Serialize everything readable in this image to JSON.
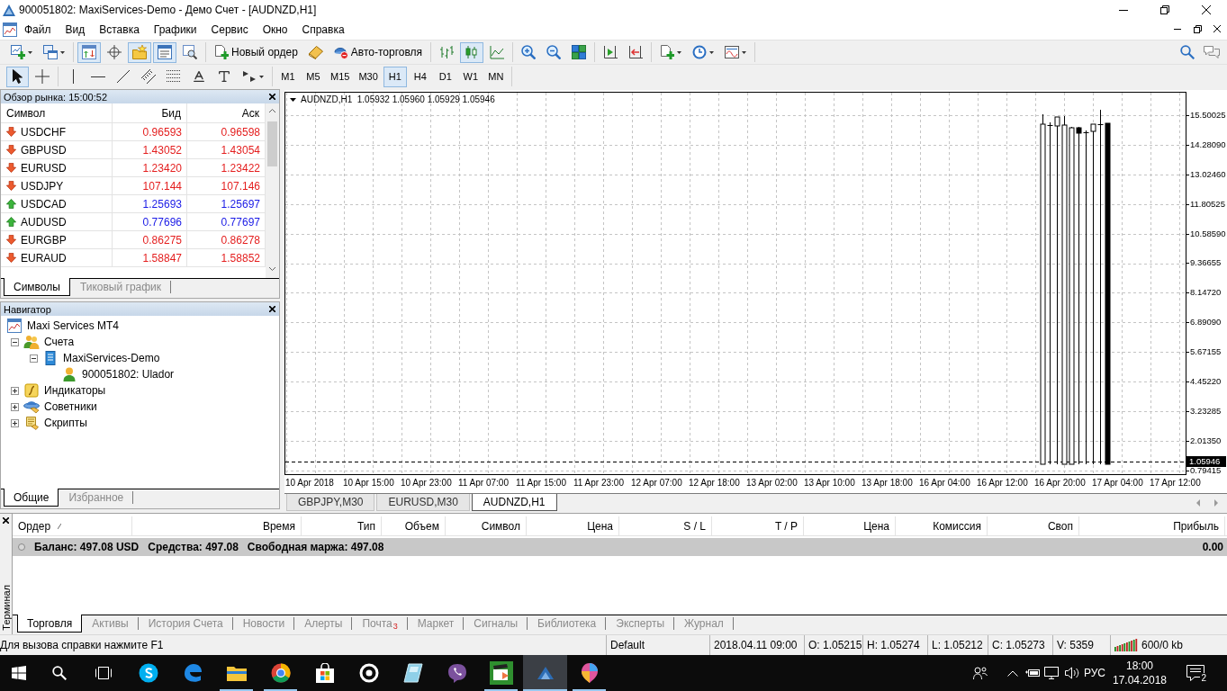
{
  "window": {
    "title": "900051802: MaxiServices-Demo - Демо Счет - [AUDNZD,H1]"
  },
  "menu": [
    "Файл",
    "Вид",
    "Вставка",
    "Графики",
    "Сервис",
    "Окно",
    "Справка"
  ],
  "toolbar": {
    "groups": [
      [
        {
          "kind": "icon",
          "pressed": false
        },
        {
          "kind": "icon",
          "pressed": false
        }
      ],
      [
        {
          "kind": "icon",
          "pressed": true
        },
        {
          "kind": "icon",
          "pressed": false
        },
        {
          "kind": "icon",
          "pressed": true
        },
        {
          "kind": "icon",
          "pressed": true
        },
        {
          "kind": "icon",
          "pressed": false
        }
      ],
      [
        {
          "kind": "labeled",
          "label": "Новый ордер",
          "pressed": false
        },
        {
          "kind": "icon",
          "pressed": false
        },
        {
          "kind": "labeled",
          "label": "Авто-торговля",
          "pressed": false
        }
      ],
      [
        {
          "kind": "icon",
          "pressed": false
        },
        {
          "kind": "icon",
          "pressed": true
        },
        {
          "kind": "icon",
          "pressed": false
        }
      ],
      [
        {
          "kind": "icon",
          "pressed": false
        },
        {
          "kind": "icon",
          "pressed": false
        },
        {
          "kind": "icon",
          "pressed": false
        }
      ],
      [
        {
          "kind": "icon",
          "pressed": false
        },
        {
          "kind": "icon",
          "pressed": false
        }
      ],
      [
        {
          "kind": "icon",
          "pressed": false
        },
        {
          "kind": "icon",
          "pressed": false
        },
        {
          "kind": "icon",
          "pressed": false
        }
      ]
    ]
  },
  "drawing_toolbar": {
    "tools": [
      {
        "pressed": true
      },
      {
        "pressed": false
      },
      {
        "pressed": false
      },
      {
        "pressed": false
      },
      {
        "pressed": false
      },
      {
        "pressed": false
      },
      {
        "pressed": false
      },
      {
        "pressed": false
      },
      {
        "pressed": false
      },
      {
        "pressed": false
      }
    ],
    "periods": [
      {
        "label": "M1",
        "selected": false
      },
      {
        "label": "M5",
        "selected": false
      },
      {
        "label": "M15",
        "selected": false
      },
      {
        "label": "M30",
        "selected": false
      },
      {
        "label": "H1",
        "selected": true
      },
      {
        "label": "H4",
        "selected": false
      },
      {
        "label": "D1",
        "selected": false
      },
      {
        "label": "W1",
        "selected": false
      },
      {
        "label": "MN",
        "selected": false
      }
    ]
  },
  "market_watch": {
    "title": "Обзор рынка: 15:00:52",
    "columns": [
      "Символ",
      "Бид",
      "Аск"
    ],
    "rows": [
      {
        "symbol": "USDCHF",
        "rising": false,
        "bid": "0.96593",
        "ask": "0.96598"
      },
      {
        "symbol": "GBPUSD",
        "rising": false,
        "bid": "1.43052",
        "ask": "1.43054"
      },
      {
        "symbol": "EURUSD",
        "rising": false,
        "bid": "1.23420",
        "ask": "1.23422"
      },
      {
        "symbol": "USDJPY",
        "rising": false,
        "bid": "107.144",
        "ask": "107.146"
      },
      {
        "symbol": "USDCAD",
        "rising": true,
        "bid": "1.25693",
        "ask": "1.25697"
      },
      {
        "symbol": "AUDUSD",
        "rising": true,
        "bid": "0.77696",
        "ask": "0.77697"
      },
      {
        "symbol": "EURGBP",
        "rising": false,
        "bid": "0.86275",
        "ask": "0.86278"
      },
      {
        "symbol": "EURAUD",
        "rising": false,
        "bid": "1.58847",
        "ask": "1.58852"
      }
    ],
    "tabs": [
      {
        "label": "Символы",
        "selected": true
      },
      {
        "label": "Тиковый график",
        "selected": false
      }
    ]
  },
  "navigator": {
    "title": "Навигатор",
    "tree": [
      {
        "label": "Maxi Services MT4",
        "kind": "terminal",
        "children": [
          {
            "label": "Счета",
            "kind": "accounts",
            "expanded": true,
            "children": [
              {
                "label": "MaxiServices-Demo",
                "kind": "server",
                "expanded": true,
                "children": [
                  {
                    "label": "900051802: Ulador",
                    "kind": "account"
                  }
                ]
              }
            ]
          },
          {
            "label": "Индикаторы",
            "kind": "indicators",
            "expanded": false
          },
          {
            "label": "Советники",
            "kind": "experts",
            "expanded": false
          },
          {
            "label": "Скрипты",
            "kind": "scripts",
            "expanded": false
          }
        ]
      }
    ],
    "tabs": [
      {
        "label": "Общие",
        "selected": true
      },
      {
        "label": "Избранное",
        "selected": false
      }
    ]
  },
  "chart": {
    "header": "AUDNZD,H1  1.05932 1.05960 1.05929 1.05946",
    "price_scale": [
      "15.50025",
      "14.28090",
      "13.02460",
      "11.80525",
      "10.58590",
      "9.36655",
      "8.14720",
      "6.89090",
      "5.67155",
      "4.45220",
      "3.23285",
      "2.01350",
      "0.79415"
    ],
    "current_price": "1.05946",
    "time_scale": [
      "10 Apr 2018",
      "10 Apr 15:00",
      "10 Apr 23:00",
      "11 Apr 07:00",
      "11 Apr 15:00",
      "11 Apr 23:00",
      "12 Apr 07:00",
      "12 Apr 18:00",
      "13 Apr 02:00",
      "13 Apr 10:00",
      "13 Apr 18:00",
      "16 Apr 04:00",
      "16 Apr 12:00",
      "16 Apr 20:00",
      "17 Apr 04:00",
      "17 Apr 12:00"
    ],
    "tabs": [
      {
        "label": "GBPJPY,M30",
        "selected": false
      },
      {
        "label": "EURUSD,M30",
        "selected": false
      },
      {
        "label": "AUDNZD,H1",
        "selected": true
      }
    ]
  },
  "terminal": {
    "label": "Терминал",
    "columns": [
      {
        "label": "Ордер",
        "sorted": true
      },
      {
        "label": "Время",
        "sorted": false
      },
      {
        "label": "Тип",
        "sorted": false
      },
      {
        "label": "Объем",
        "sorted": false
      },
      {
        "label": "Символ",
        "sorted": false
      },
      {
        "label": "Цена",
        "sorted": false
      },
      {
        "label": "S / L",
        "sorted": false
      },
      {
        "label": "T / P",
        "sorted": false
      },
      {
        "label": "Цена",
        "sorted": false
      },
      {
        "label": "Комиссия",
        "sorted": false
      },
      {
        "label": "Своп",
        "sorted": false
      },
      {
        "label": "Прибыль",
        "sorted": false
      }
    ],
    "summary": {
      "balance": "Баланс: 497.08 USD",
      "equity": "Средства: 497.08",
      "free_margin": "Свободная маржа: 497.08",
      "profit": "0.00"
    },
    "tabs": [
      {
        "label": "Торговля",
        "selected": true
      },
      {
        "label": "Активы",
        "selected": false
      },
      {
        "label": "История Счета",
        "selected": false
      },
      {
        "label": "Новости",
        "selected": false
      },
      {
        "label": "Алерты",
        "selected": false
      },
      {
        "label": "Почта",
        "badge": "3",
        "selected": false
      },
      {
        "label": "Маркет",
        "selected": false
      },
      {
        "label": "Сигналы",
        "selected": false
      },
      {
        "label": "Библиотека",
        "selected": false
      },
      {
        "label": "Эксперты",
        "selected": false
      },
      {
        "label": "Журнал",
        "selected": false
      }
    ]
  },
  "status_bar": {
    "hint": "Для вызова справки нажмите F1",
    "profile": "Default",
    "time": "2018.04.11 09:00",
    "open": "O: 1.05215",
    "high": "H: 1.05274",
    "low": "L: 1.05212",
    "close": "C: 1.05273",
    "volume": "V: 5359",
    "traffic": "600/0 kb"
  },
  "taskbar": {
    "apps": [
      {
        "running": false,
        "active": false
      },
      {
        "running": false,
        "active": false
      },
      {
        "running": true,
        "active": false
      },
      {
        "running": true,
        "active": false
      },
      {
        "running": false,
        "active": false
      },
      {
        "running": false,
        "active": false
      },
      {
        "running": false,
        "active": false
      },
      {
        "running": false,
        "active": false
      },
      {
        "running": true,
        "active": false
      },
      {
        "running": true,
        "active": true
      },
      {
        "running": true,
        "active": false
      }
    ],
    "language": "РУС",
    "time": "18:00",
    "date": "17.04.2018",
    "notifications": "2"
  }
}
